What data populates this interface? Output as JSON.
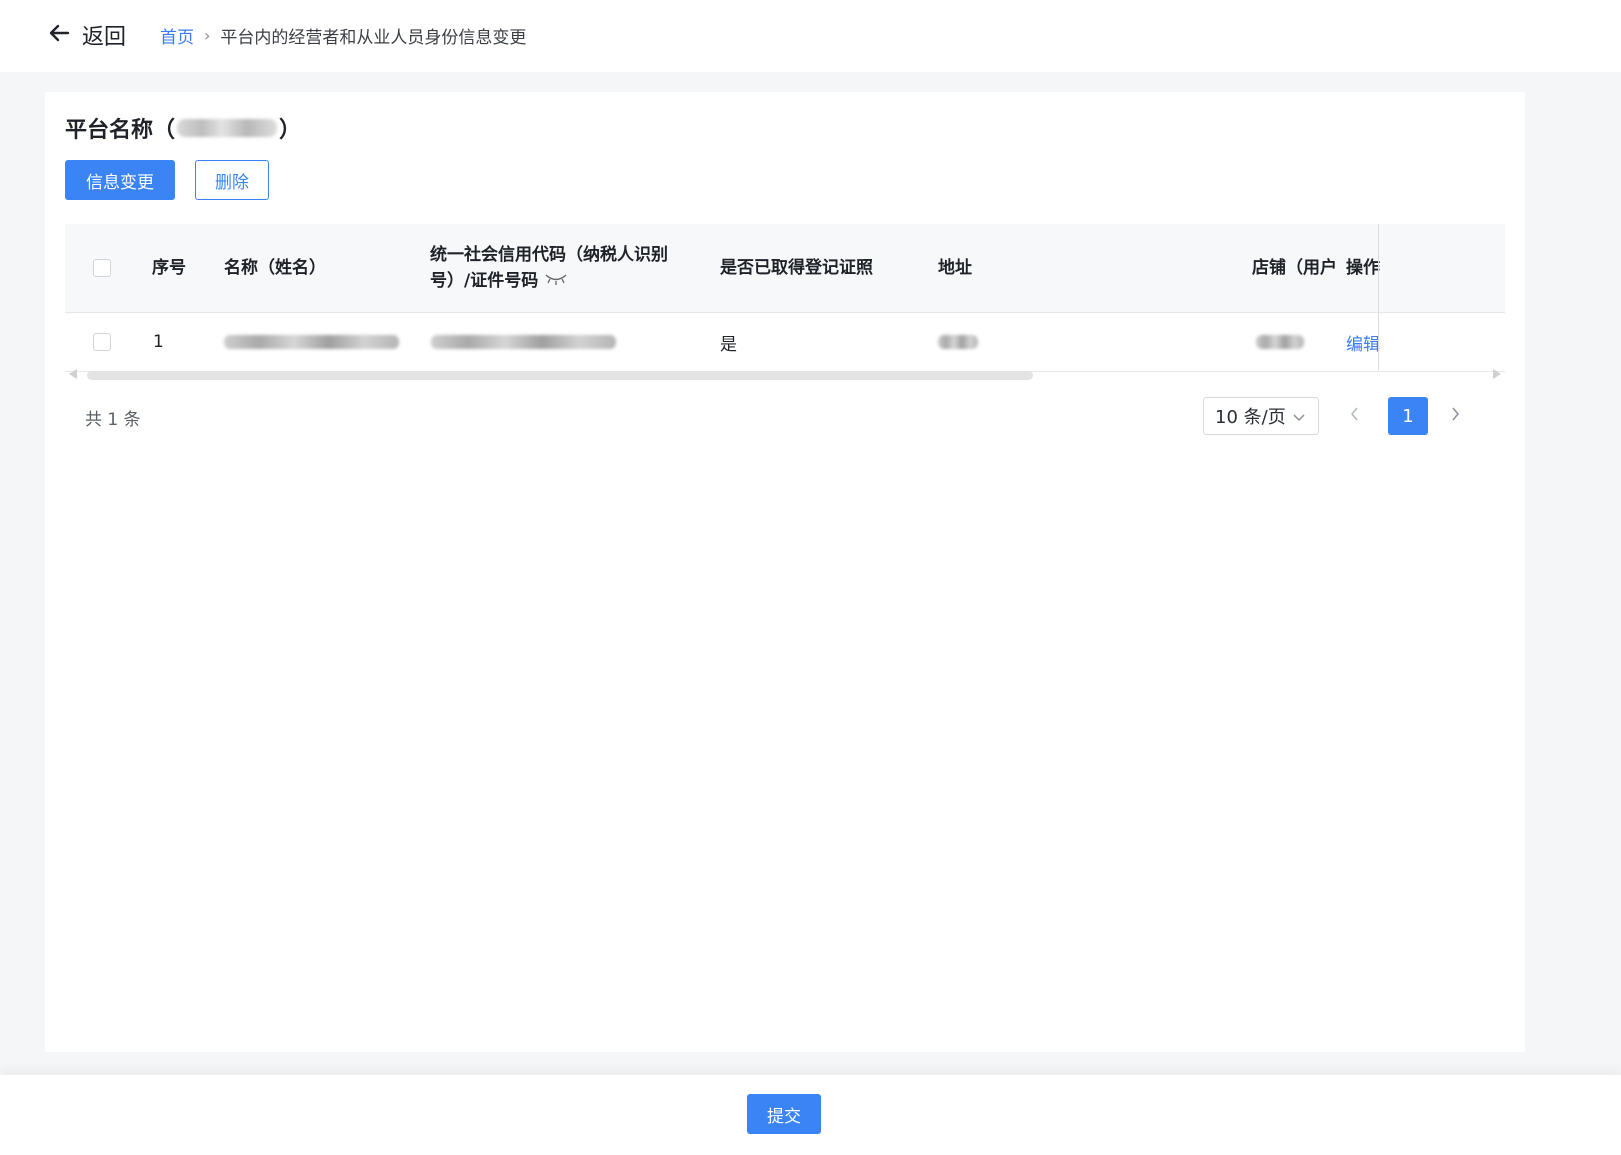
{
  "header": {
    "back_label": "返回",
    "breadcrumb": {
      "home": "首页",
      "separator": "›",
      "current": "平台内的经营者和从业人员身份信息变更"
    }
  },
  "card": {
    "title_prefix": "平台名称（",
    "title_suffix": "）",
    "buttons": {
      "change_label": "信息变更",
      "delete_label": "删除"
    }
  },
  "table": {
    "columns": {
      "index": "序号",
      "name": "名称（姓名）",
      "credit_code_line1": "统一社会信用代码（纳税人识别",
      "credit_code_line2": "号）/证件号码",
      "licensed": "是否已取得登记证照",
      "address": "地址",
      "shop": "店铺（用户",
      "action": "操作"
    },
    "rows": [
      {
        "index": "1",
        "licensed": "是",
        "action": "编辑"
      }
    ]
  },
  "pagination": {
    "total_text": "共 1 条",
    "page_size": "10 条/页",
    "current_page": "1"
  },
  "footer": {
    "submit_label": "提交"
  },
  "colors": {
    "primary": "#3a84f6",
    "link": "#3a7bf3",
    "page_bg": "#f5f6f8",
    "header_row_bg": "#f7f8fa"
  },
  "icons": [
    "arrow-left-icon",
    "eye-closed-icon",
    "chevron-down-icon",
    "chevron-left-icon",
    "chevron-right-icon"
  ]
}
